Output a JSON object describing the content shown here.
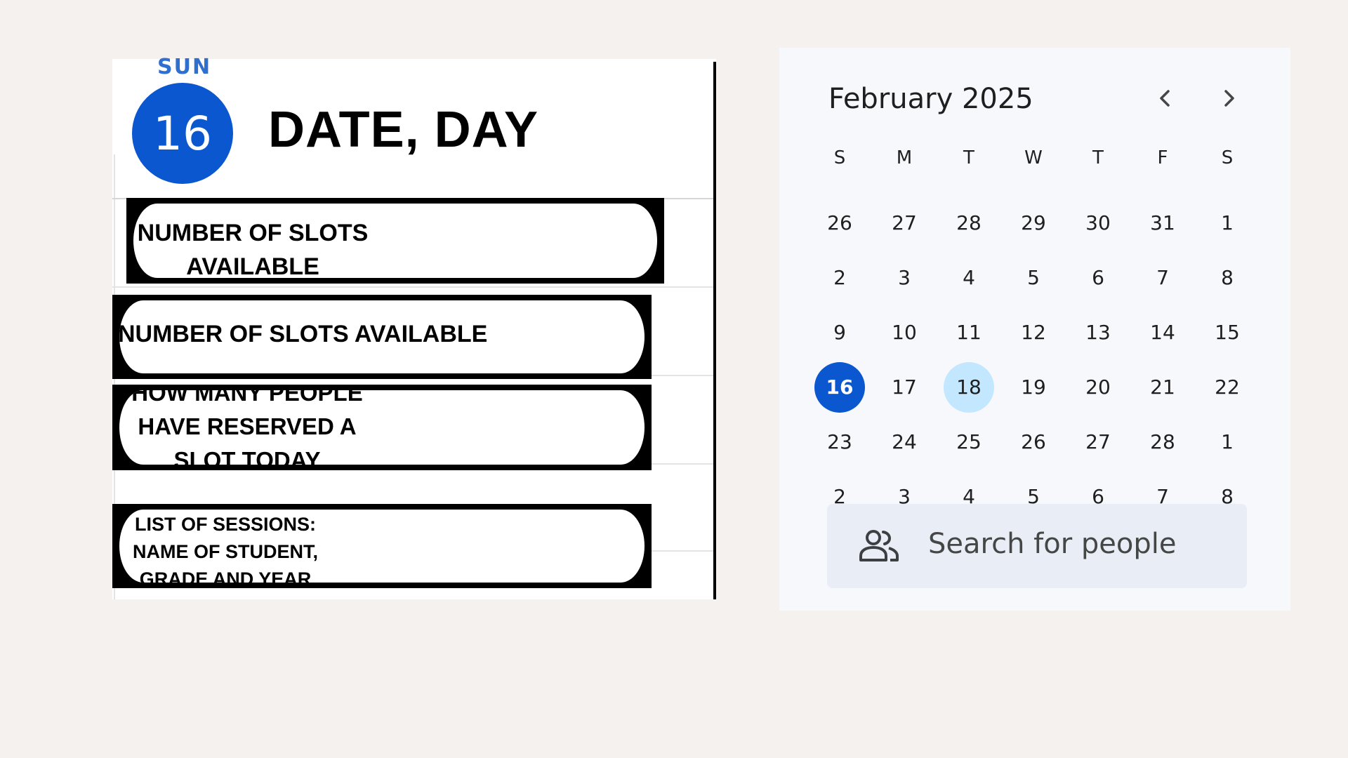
{
  "day_view": {
    "day_of_week": "SUN",
    "date_number": "16",
    "heading": "DATE, DAY",
    "slots": [
      {
        "text": "NUMBER OF SLOTS\nAVAILABLE"
      },
      {
        "text": "NUMBER OF SLOTS AVAILABLE"
      },
      {
        "text": "HOW MANY PEOPLE\nHAVE RESERVED A\nSLOT TODAY"
      },
      {
        "text": "LIST OF SESSIONS:\nNAME OF STUDENT,\nGRADE AND YEAR"
      }
    ]
  },
  "mini_calendar": {
    "month_label": "February 2025",
    "prev_icon": "chevron-left-icon",
    "next_icon": "chevron-right-icon",
    "weekdays": [
      "S",
      "M",
      "T",
      "W",
      "T",
      "F",
      "S"
    ],
    "weeks": [
      [
        "26",
        "27",
        "28",
        "29",
        "30",
        "31",
        "1"
      ],
      [
        "2",
        "3",
        "4",
        "5",
        "6",
        "7",
        "8"
      ],
      [
        "9",
        "10",
        "11",
        "12",
        "13",
        "14",
        "15"
      ],
      [
        "16",
        "17",
        "18",
        "19",
        "20",
        "21",
        "22"
      ],
      [
        "23",
        "24",
        "25",
        "26",
        "27",
        "28",
        "1"
      ],
      [
        "2",
        "3",
        "4",
        "5",
        "6",
        "7",
        "8"
      ]
    ],
    "selected_day": "16",
    "today_day": "18",
    "accent_color": "#0b57d0",
    "today_color": "#c2e7ff"
  },
  "search": {
    "icon": "people-icon",
    "placeholder": "Search for people"
  }
}
